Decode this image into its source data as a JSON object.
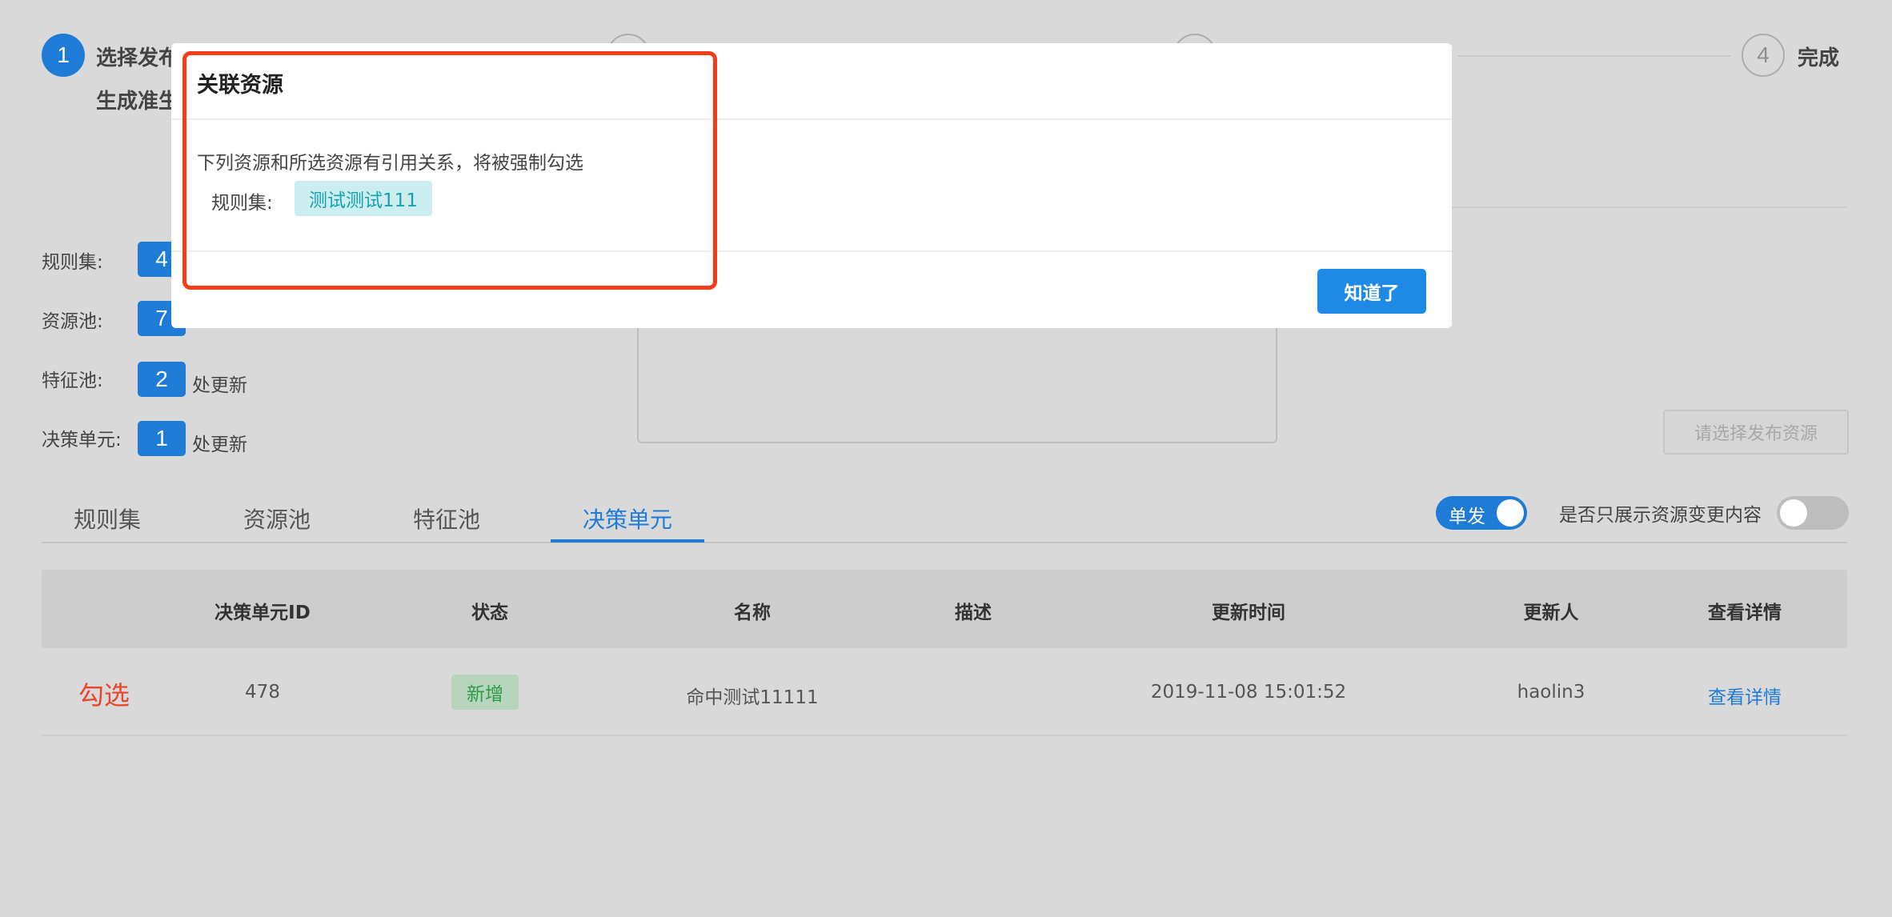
{
  "steps": [
    {
      "number": "1",
      "title_line1": "选择发布",
      "title_line2": "生成准生",
      "state": "active"
    },
    {
      "number": "",
      "title_line1": "",
      "state": "idle"
    },
    {
      "number": "",
      "title_line1": "",
      "state": "idle"
    },
    {
      "number": "4",
      "title_line1": "完成",
      "state": "idle"
    }
  ],
  "counts": [
    {
      "label": "规则集:",
      "count": "4",
      "suffix": ""
    },
    {
      "label": "资源池:",
      "count": "7",
      "suffix": ""
    },
    {
      "label": "特征池:",
      "count": "2",
      "suffix": "处更新"
    },
    {
      "label": "决策单元:",
      "count": "1",
      "suffix": "处更新"
    }
  ],
  "actions": {
    "select_publish_resource": "请选择发布资源"
  },
  "tabs": [
    {
      "label": "规则集",
      "active": false
    },
    {
      "label": "资源池",
      "active": false
    },
    {
      "label": "特征池",
      "active": false
    },
    {
      "label": "决策单元",
      "active": true
    }
  ],
  "toggles": {
    "single_label": "单发",
    "single_on": true,
    "only_changes_label": "是否只展示资源变更内容",
    "only_changes_on": false
  },
  "table": {
    "headers": [
      "决策单元ID",
      "状态",
      "名称",
      "描述",
      "更新时间",
      "更新人",
      "查看详情"
    ],
    "rows": [
      {
        "id": "478",
        "status": "新增",
        "name": "命中测试11111",
        "desc": "",
        "updated_at": "2019-11-08 15:01:52",
        "updated_by": "haolin3",
        "detail": "查看详情"
      }
    ]
  },
  "annotation": "勾选",
  "modal": {
    "title": "关联资源",
    "message": "下列资源和所选资源有引用关系，将被强制勾选",
    "kv_label": "规则集:",
    "kv_tag": "测试测试111",
    "ok_button": "知道了"
  },
  "colors": {
    "accent": "#1e7bd6",
    "overlay_bg": "#d9d9d9",
    "status_new_bg": "#b7d4bd",
    "status_new_fg": "#2e9a45",
    "tag_cyan_bg": "#cdeef1",
    "tag_cyan_fg": "#16a3b0",
    "highlight_red": "#f23d1b"
  }
}
